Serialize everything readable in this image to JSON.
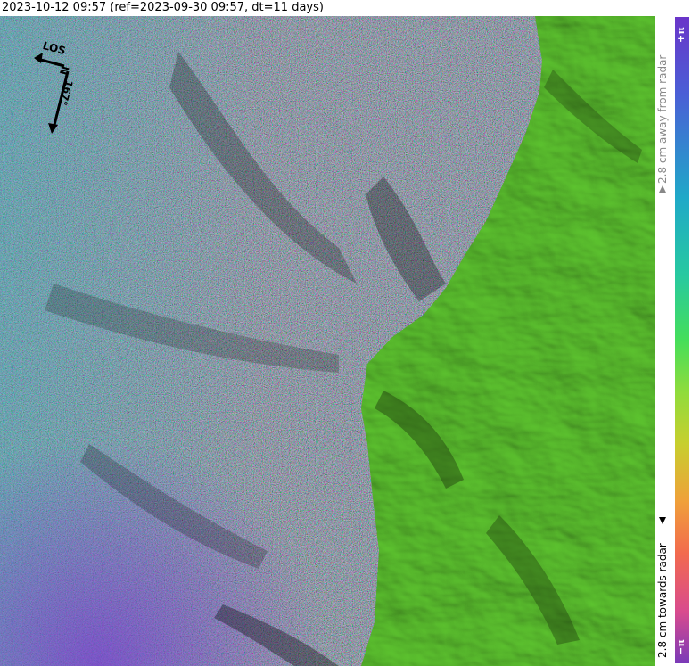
{
  "title": "2023-10-12 09:57 (ref=2023-09-30 09:57, dt=11 days)",
  "compass": {
    "los_label": "LOS",
    "north_label": "N",
    "heading_label": "167°",
    "heading_value": 167
  },
  "colorbar": {
    "top_label": "+π",
    "bottom_label": "−π",
    "away_label": "2.8 cm away from radar",
    "towards_label": "2.8 cm towards radar",
    "colors": [
      "#6a35c9",
      "#4a5fd6",
      "#1fa9c8",
      "#27c9a0",
      "#45de5a",
      "#8fdc3c",
      "#c7cf2e",
      "#f0a03a",
      "#f26a4e",
      "#d94b8e",
      "#7a3ab8"
    ]
  },
  "map": {
    "coherent_area_color": "#5fc930",
    "noisy_area_colors": [
      "#7a6f8a",
      "#8f7d6a",
      "#5f8a8f",
      "#a07f9a"
    ]
  }
}
